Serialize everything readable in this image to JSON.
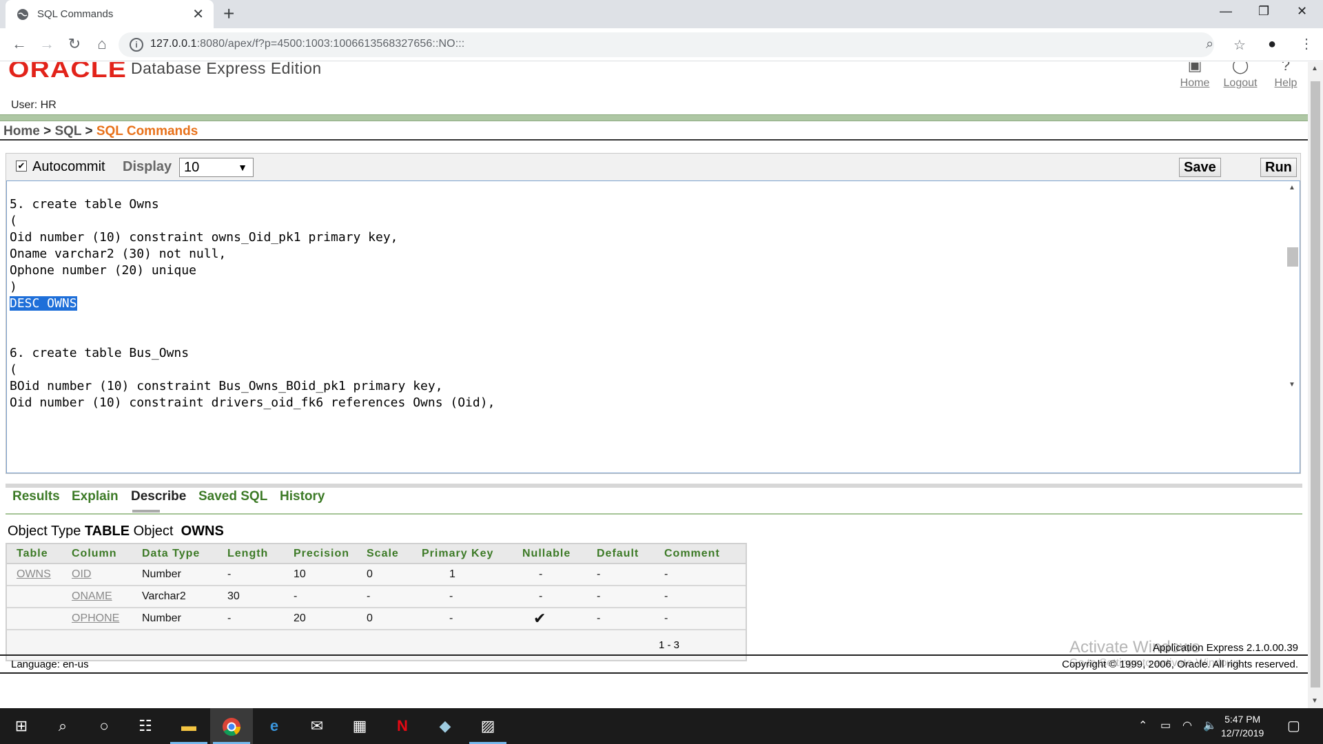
{
  "browser": {
    "tab_title": "SQL Commands",
    "tab_close": "✕",
    "new_tab": "+",
    "url_host": "127.0.0.1",
    "url_rest": ":8080/apex/f?p=4500:1003:1006613568327656::NO:::",
    "window_controls": [
      "—",
      "❐",
      "✕"
    ],
    "icons": [
      "back-icon",
      "forward-icon",
      "reload-icon",
      "home-icon",
      "info-icon",
      "zoom-icon",
      "star-icon",
      "profile-icon",
      "menu-icon"
    ]
  },
  "header": {
    "logo": "ORACLE",
    "product": "Database Express Edition",
    "links": [
      {
        "label": "Home",
        "icon": "home-icon"
      },
      {
        "label": "Logout",
        "icon": "logout-icon"
      },
      {
        "label": "Help",
        "icon": "help-icon"
      }
    ],
    "user": "User: HR"
  },
  "breadcrumb": {
    "home": "Home",
    "sql": "SQL",
    "current": "SQL Commands",
    "sep": ">"
  },
  "editor_toolbar": {
    "autocommit_checked": true,
    "autocommit_label": "Autocommit",
    "display_label": "Display",
    "display_value": "10",
    "save_label": "Save",
    "run_label": "Run"
  },
  "code": {
    "lines": [
      "5. create table Owns",
      "(",
      "Oid number (10) constraint owns_Oid_pk1 primary key,",
      "Oname varchar2 (30) not null,",
      "Ophone number (20) unique",
      ")",
      "DESC OWNS",
      "",
      "",
      "6. create table Bus_Owns",
      "(",
      "BOid number (10) constraint Bus_Owns_BOid_pk1 primary key,",
      "Oid number (10) constraint drivers_oid_fk6 references Owns (Oid),"
    ],
    "selected_line": "DESC OWNS"
  },
  "result_tabs": [
    "Results",
    "Explain",
    "Describe",
    "Saved SQL",
    "History"
  ],
  "active_tab": "Describe",
  "object_line": {
    "type_label": "Object Type",
    "type_value": "TABLE",
    "object_label": "Object",
    "object_value": "OWNS"
  },
  "describe_table": {
    "columns": [
      "Table",
      "Column",
      "Data Type",
      "Length",
      "Precision",
      "Scale",
      "Primary Key",
      "Nullable",
      "Default",
      "Comment"
    ],
    "rows": [
      [
        "OWNS",
        "OID",
        "Number",
        "-",
        "10",
        "0",
        "1",
        "-",
        "-",
        "-"
      ],
      [
        "",
        "ONAME",
        "Varchar2",
        "30",
        "-",
        "-",
        "-",
        "-",
        "-",
        "-"
      ],
      [
        "",
        "OPHONE",
        "Number",
        "-",
        "20",
        "0",
        "-",
        "✔",
        "-",
        "-"
      ]
    ],
    "pagination": "1 - 3"
  },
  "footer": {
    "language": "Language: en-us",
    "version": "Application Express 2.1.0.00.39",
    "copyright": "Copyright © 1999, 2006, Oracle. All rights reserved.",
    "watermark": "Activate Windows",
    "watermark_sub": "Go to Settings to activate Windows."
  },
  "taskbar": {
    "time": "5:47 PM",
    "date": "12/7/2019",
    "apps": [
      "start-icon",
      "search-icon",
      "cortana-icon",
      "task-view-icon",
      "file-explorer-icon",
      "chrome-icon",
      "edge-icon",
      "mail-icon",
      "store-icon",
      "netflix-icon",
      "app-icon",
      "photos-icon"
    ]
  }
}
